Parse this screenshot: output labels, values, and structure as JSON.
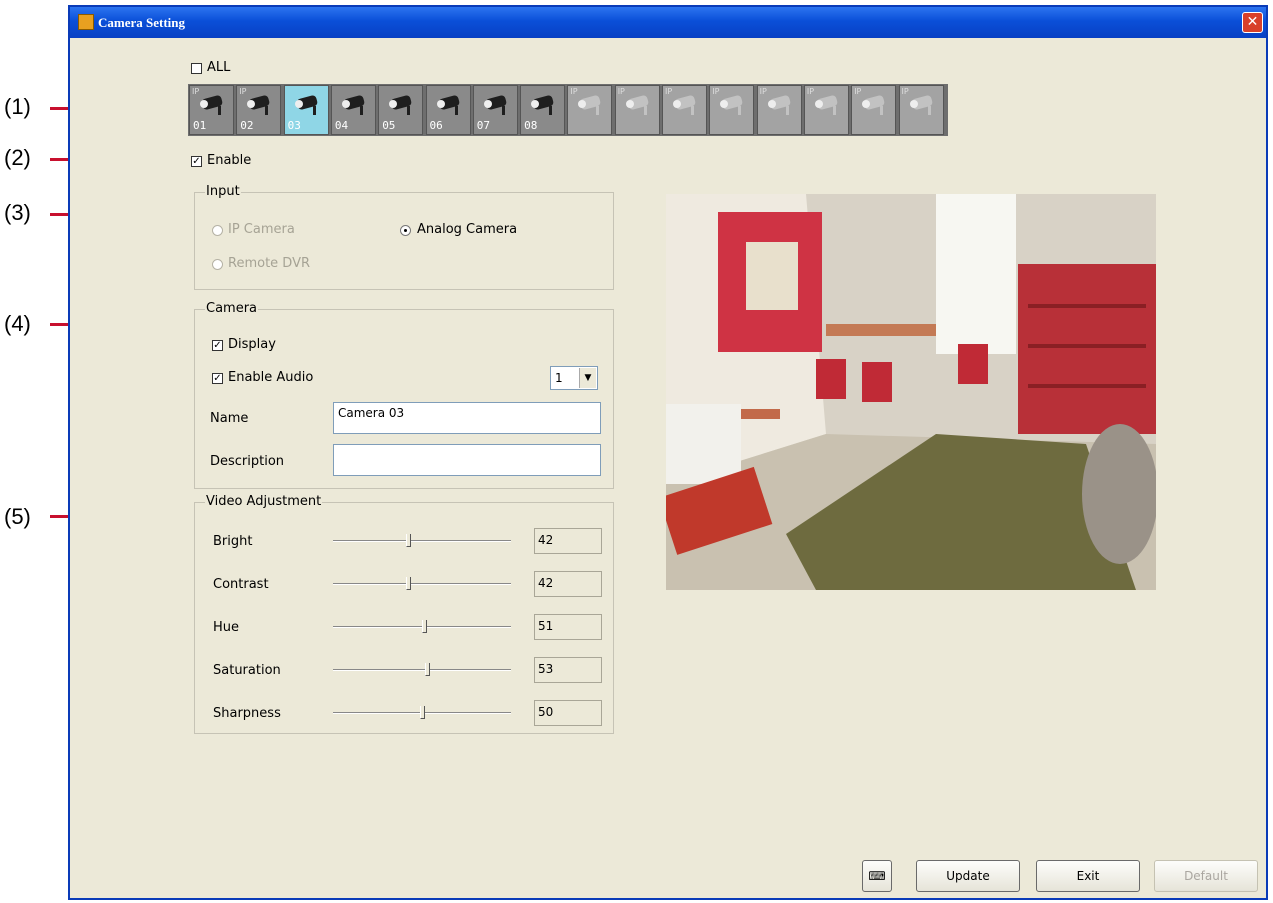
{
  "callouts": [
    "(1)",
    "(2)",
    "(3)",
    "(4)",
    "(5)"
  ],
  "window": {
    "title": "Camera Setting",
    "close": "✕"
  },
  "all_checkbox": {
    "label": "ALL",
    "checked": false
  },
  "camera_tiles": [
    {
      "num": "01",
      "type": "IP",
      "state": "active"
    },
    {
      "num": "02",
      "type": "IP",
      "state": "active"
    },
    {
      "num": "03",
      "type": "",
      "state": "selected"
    },
    {
      "num": "04",
      "type": "",
      "state": "active"
    },
    {
      "num": "05",
      "type": "",
      "state": "active"
    },
    {
      "num": "06",
      "type": "",
      "state": "active"
    },
    {
      "num": "07",
      "type": "",
      "state": "active"
    },
    {
      "num": "08",
      "type": "",
      "state": "active"
    },
    {
      "num": "",
      "type": "IP",
      "state": "disabled"
    },
    {
      "num": "",
      "type": "IP",
      "state": "disabled"
    },
    {
      "num": "",
      "type": "IP",
      "state": "disabled"
    },
    {
      "num": "",
      "type": "IP",
      "state": "disabled"
    },
    {
      "num": "",
      "type": "IP",
      "state": "disabled"
    },
    {
      "num": "",
      "type": "IP",
      "state": "disabled"
    },
    {
      "num": "",
      "type": "IP",
      "state": "disabled"
    },
    {
      "num": "",
      "type": "IP",
      "state": "disabled"
    }
  ],
  "enable": {
    "label": "Enable",
    "checked": true
  },
  "input_group": {
    "title": "Input",
    "ip_camera": "IP Camera",
    "analog_camera": "Analog Camera",
    "remote_dvr": "Remote DVR",
    "selected": "Analog Camera"
  },
  "camera_group": {
    "title": "Camera",
    "display_label": "Display",
    "enable_audio_label": "Enable Audio",
    "audio_channel": "1",
    "name_label": "Name",
    "name_value": "Camera 03",
    "description_label": "Description",
    "description_value": ""
  },
  "video_adjustment": {
    "title": "Video Adjustment",
    "items": [
      {
        "label": "Bright",
        "value": "42",
        "level": 42
      },
      {
        "label": "Contrast",
        "value": "42",
        "level": 42
      },
      {
        "label": "Hue",
        "value": "51",
        "level": 51
      },
      {
        "label": "Saturation",
        "value": "53",
        "level": 53
      },
      {
        "label": "Sharpness",
        "value": "50",
        "level": 50
      }
    ]
  },
  "buttons": {
    "update": "Update",
    "exit": "Exit",
    "default": "Default"
  },
  "colors": {
    "callout_line": "#c8102e",
    "title_bar": "#0a4fd8",
    "window_bg": "#ece9d8",
    "selected_tile": "#8fd6e6"
  }
}
